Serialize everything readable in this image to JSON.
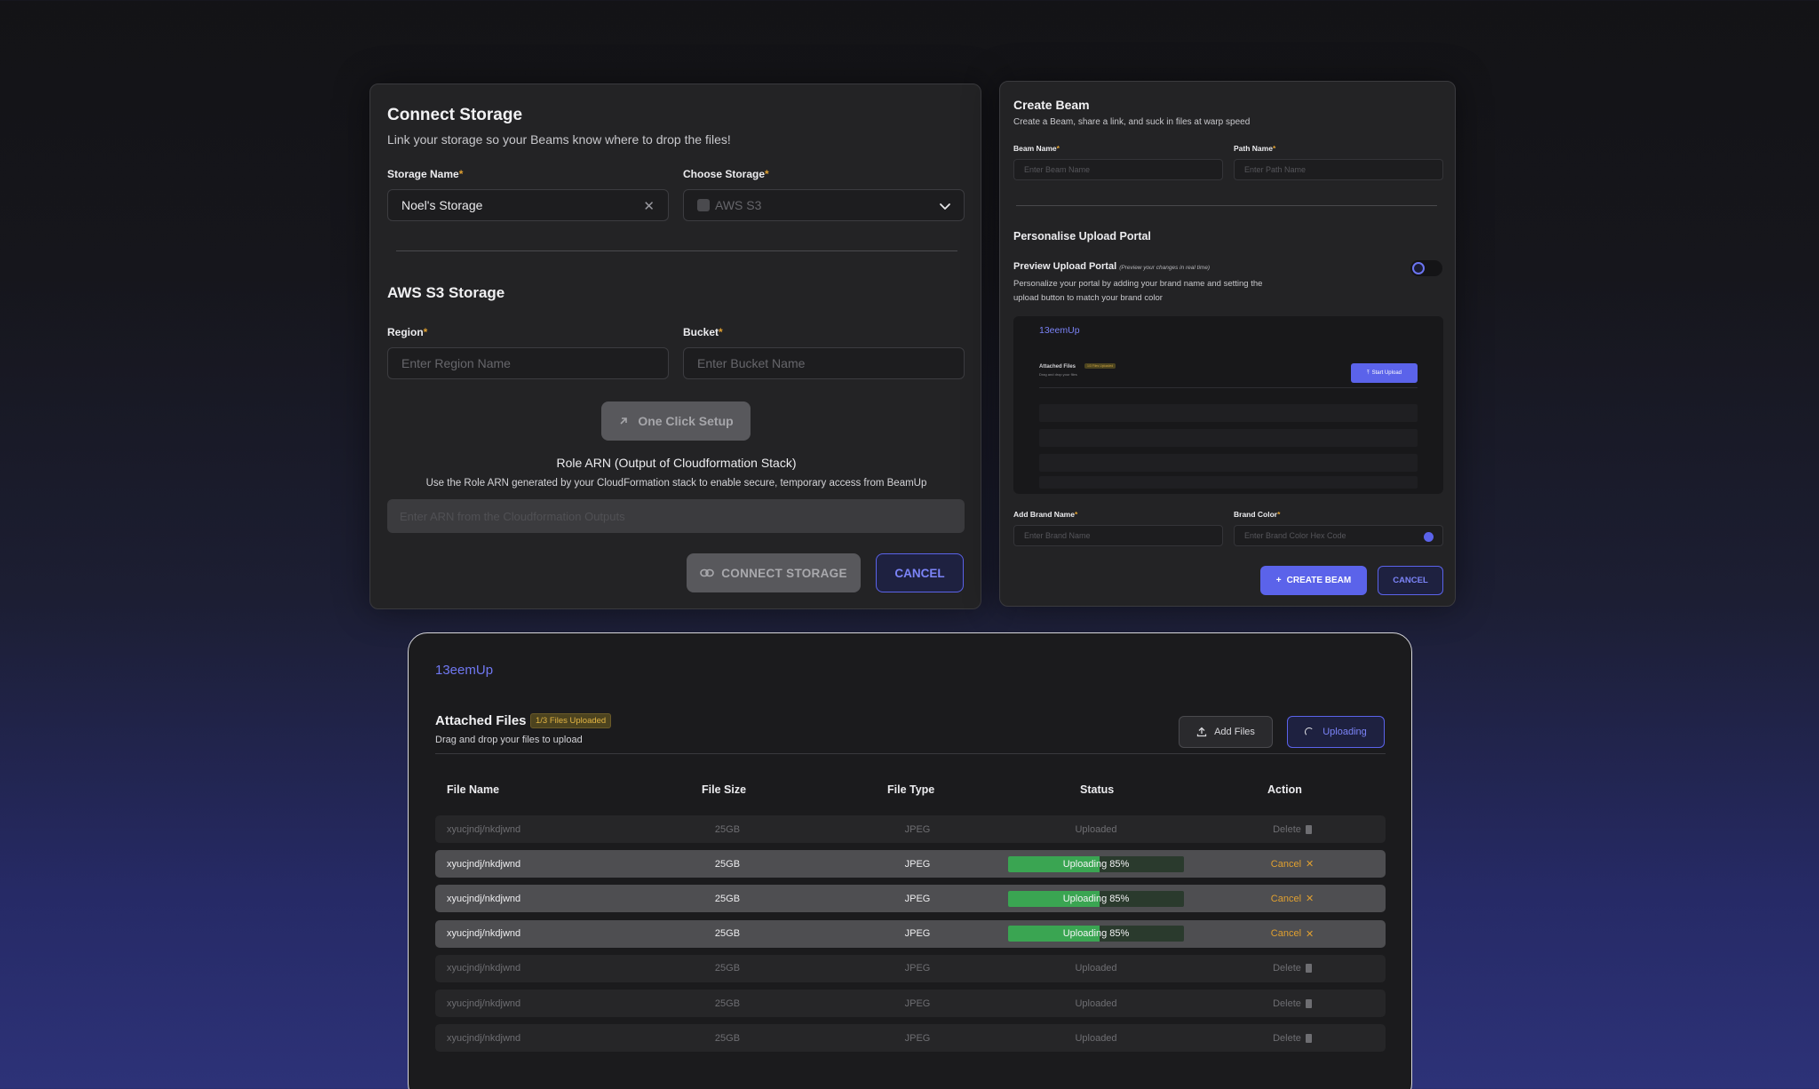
{
  "connect_storage": {
    "title": "Connect Storage",
    "subtitle": "Link your storage so your Beams know where to drop the files!",
    "storage_name_label": "Storage Name",
    "storage_name_value": "Noel's Storage",
    "choose_storage_label": "Choose Storage",
    "choose_storage_value": "AWS S3",
    "section_title": "AWS S3 Storage",
    "region_label": "Region",
    "region_placeholder": "Enter Region Name",
    "bucket_label": "Bucket",
    "bucket_placeholder": "Enter Bucket Name",
    "one_click_label": "One Click Setup",
    "role_title": "Role ARN (Output of Cloudformation Stack)",
    "role_desc": "Use the Role ARN generated by your CloudFormation stack to enable secure, temporary access from BeamUp",
    "role_placeholder": "Enter ARN from the Cloudformation Outputs",
    "connect_label": "CONNECT STORAGE",
    "cancel_label": "CANCEL"
  },
  "create_beam": {
    "title": "Create Beam",
    "subtitle": "Create a Beam, share a link, and suck in files at warp speed",
    "beam_name_label": "Beam Name",
    "beam_name_placeholder": "Enter Beam Name",
    "path_name_label": "Path Name",
    "path_name_placeholder": "Enter Path Name",
    "section_title": "Personalise Upload Portal",
    "preview_title": "Preview Upload Portal",
    "preview_hint": "(Preview your changes in real time)",
    "preview_desc": "Personalize your portal by adding your brand name and setting the upload button to match your brand color",
    "preview_brand": "13eemUp",
    "preview_attached": "Attached Files",
    "preview_badge": "1/3 Files Uploaded",
    "preview_sub": "Drag and drop your files",
    "preview_start": "Start Upload",
    "brand_name_label": "Add Brand Name",
    "brand_name_placeholder": "Enter Brand Name",
    "brand_color_label": "Brand Color",
    "brand_color_placeholder": "Enter Brand Color Hex Code",
    "brand_color": "#5b63ea",
    "create_label": "CREATE BEAM",
    "cancel_label": "CANCEL"
  },
  "upload_portal": {
    "brand": "13eemUp",
    "title": "Attached Files",
    "badge": "1/3 Files Uploaded",
    "subtitle": "Drag and drop your files to upload",
    "add_files_label": "Add Files",
    "uploading_label": "Uploading",
    "columns": [
      "File Name",
      "File Size",
      "File Type",
      "Status",
      "Action"
    ],
    "rows": [
      {
        "name": "xyucjndj/nkdjwnd",
        "size": "25GB",
        "type": "JPEG",
        "status": "Uploaded",
        "action": "Delete"
      },
      {
        "name": "xyucjndj/nkdjwnd",
        "size": "25GB",
        "type": "JPEG",
        "status": "Uploading 85%",
        "action": "Cancel"
      },
      {
        "name": "xyucjndj/nkdjwnd",
        "size": "25GB",
        "type": "JPEG",
        "status": "Uploading 85%",
        "action": "Cancel"
      },
      {
        "name": "xyucjndj/nkdjwnd",
        "size": "25GB",
        "type": "JPEG",
        "status": "Uploading 85%",
        "action": "Cancel"
      },
      {
        "name": "xyucjndj/nkdjwnd",
        "size": "25GB",
        "type": "JPEG",
        "status": "Uploaded",
        "action": "Delete"
      },
      {
        "name": "xyucjndj/nkdjwnd",
        "size": "25GB",
        "type": "JPEG",
        "status": "Uploaded",
        "action": "Delete"
      },
      {
        "name": "xyucjndj/nkdjwnd",
        "size": "25GB",
        "type": "JPEG",
        "status": "Uploaded",
        "action": "Delete"
      }
    ],
    "progress_percent": 52
  },
  "colors": {
    "accent": "#5b63ea",
    "progress": "#3aa552",
    "warning": "#e0a030"
  }
}
